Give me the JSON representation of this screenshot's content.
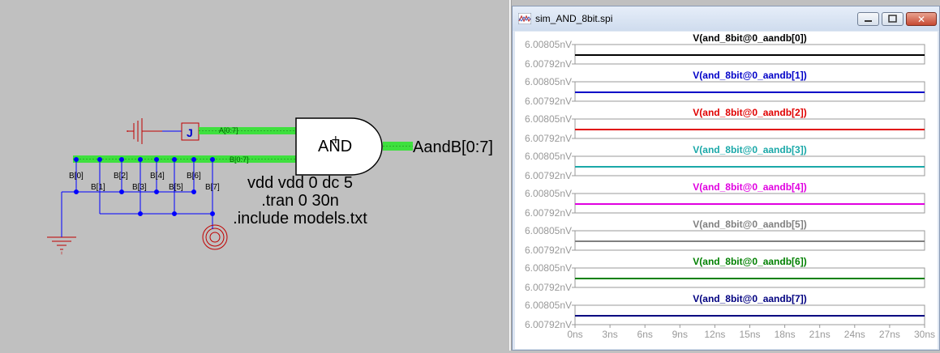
{
  "schematic": {
    "gate_label": "AND",
    "input_a_label": "A[0:7]",
    "input_b_label": "B[0:7]",
    "output_label": "AandB[0:7]",
    "bus_b_bits": [
      "B[0]",
      "B[1]",
      "B[2]",
      "B[3]",
      "B[4]",
      "B[5]",
      "B[6]",
      "B[7]"
    ],
    "directives": [
      "vdd vdd 0 dc 5",
      ".tran 0 30n",
      ".include models.txt"
    ],
    "jumper_label": "J"
  },
  "waveform_window": {
    "title": "sim_AND_8bit.spi",
    "y_tick_top": "6.00805nV",
    "y_tick_bottom": "6.00792nV",
    "x_ticks": [
      "0ns",
      "3ns",
      "6ns",
      "9ns",
      "12ns",
      "15ns",
      "18ns",
      "21ns",
      "24ns",
      "27ns",
      "30ns"
    ],
    "traces": [
      {
        "name": "V(and_8bit@0_aandb[0])",
        "color": "#000000"
      },
      {
        "name": "V(and_8bit@0_aandb[1])",
        "color": "#0000c8"
      },
      {
        "name": "V(and_8bit@0_aandb[2])",
        "color": "#e00000"
      },
      {
        "name": "V(and_8bit@0_aandb[3])",
        "color": "#1aa8a8"
      },
      {
        "name": "V(and_8bit@0_aandb[4])",
        "color": "#e000e0"
      },
      {
        "name": "V(and_8bit@0_aandb[5])",
        "color": "#808080"
      },
      {
        "name": "V(and_8bit@0_aandb[6])",
        "color": "#008000"
      },
      {
        "name": "V(and_8bit@0_aandb[7])",
        "color": "#000080"
      }
    ]
  }
}
